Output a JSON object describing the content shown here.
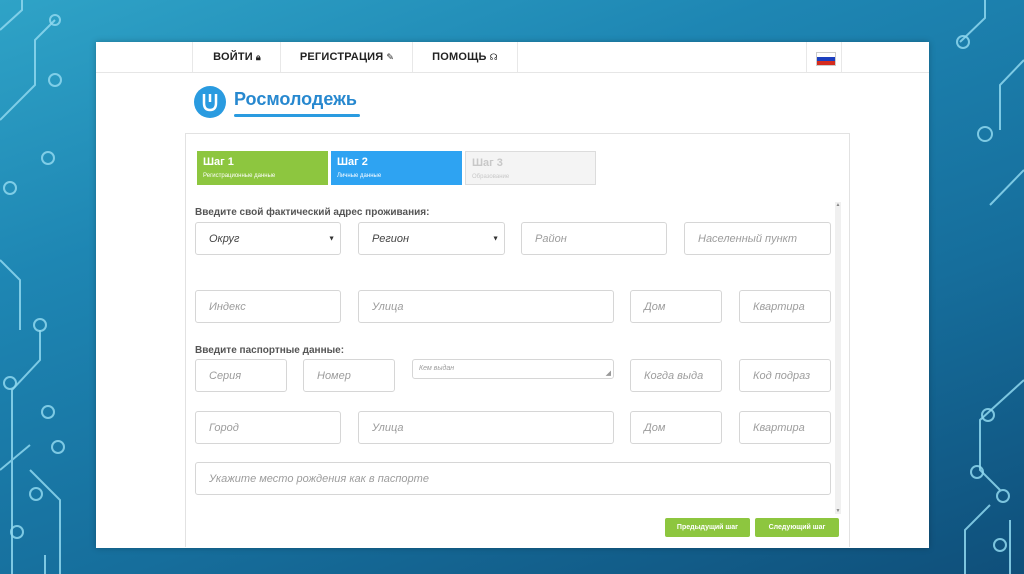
{
  "nav": {
    "login_label": "ВОЙТИ",
    "login_icon": "lock-icon",
    "register_label": "РЕГИСТРАЦИЯ",
    "register_icon": "edit-icon",
    "help_label": "ПОМОЩЬ",
    "help_icon": "headphones-icon",
    "language_flag": "russia-flag-icon"
  },
  "brand": {
    "name": "Росмолодежь",
    "color": "#2a9be0"
  },
  "steps": [
    {
      "title": "Шаг 1",
      "subtitle": "Регистрационные данные",
      "color": "#8dc63f"
    },
    {
      "title": "Шаг 2",
      "subtitle": "Личные данные",
      "color": "#2ea3f2"
    },
    {
      "title": "Шаг 3",
      "subtitle": "Образование",
      "color": "#f4f4f4"
    }
  ],
  "address": {
    "label": "Введите свой фактический адрес проживания:",
    "okrug": "Округ",
    "region": "Регион",
    "district_placeholder": "Район",
    "locality_placeholder": "Населенный пункт",
    "index_placeholder": "Индекс",
    "street_placeholder": "Улица",
    "house_placeholder": "Дом",
    "apartment_placeholder": "Квартира"
  },
  "passport": {
    "label": "Введите паспортные данные:",
    "series_placeholder": "Серия",
    "number_placeholder": "Номер",
    "issued_by_placeholder": "Кем выдан",
    "issued_when_placeholder": "Когда выда",
    "code_placeholder": "Код подраз",
    "city_placeholder": "Город",
    "street_placeholder": "Улица",
    "house_placeholder": "Дом",
    "apartment_placeholder": "Квартира",
    "birthplace_placeholder": "Укажите место рождения как в паспорте"
  },
  "buttons": {
    "prev_label": "Предыдущий шаг",
    "next_label": "Следующий шаг",
    "color": "#8dc63f"
  }
}
